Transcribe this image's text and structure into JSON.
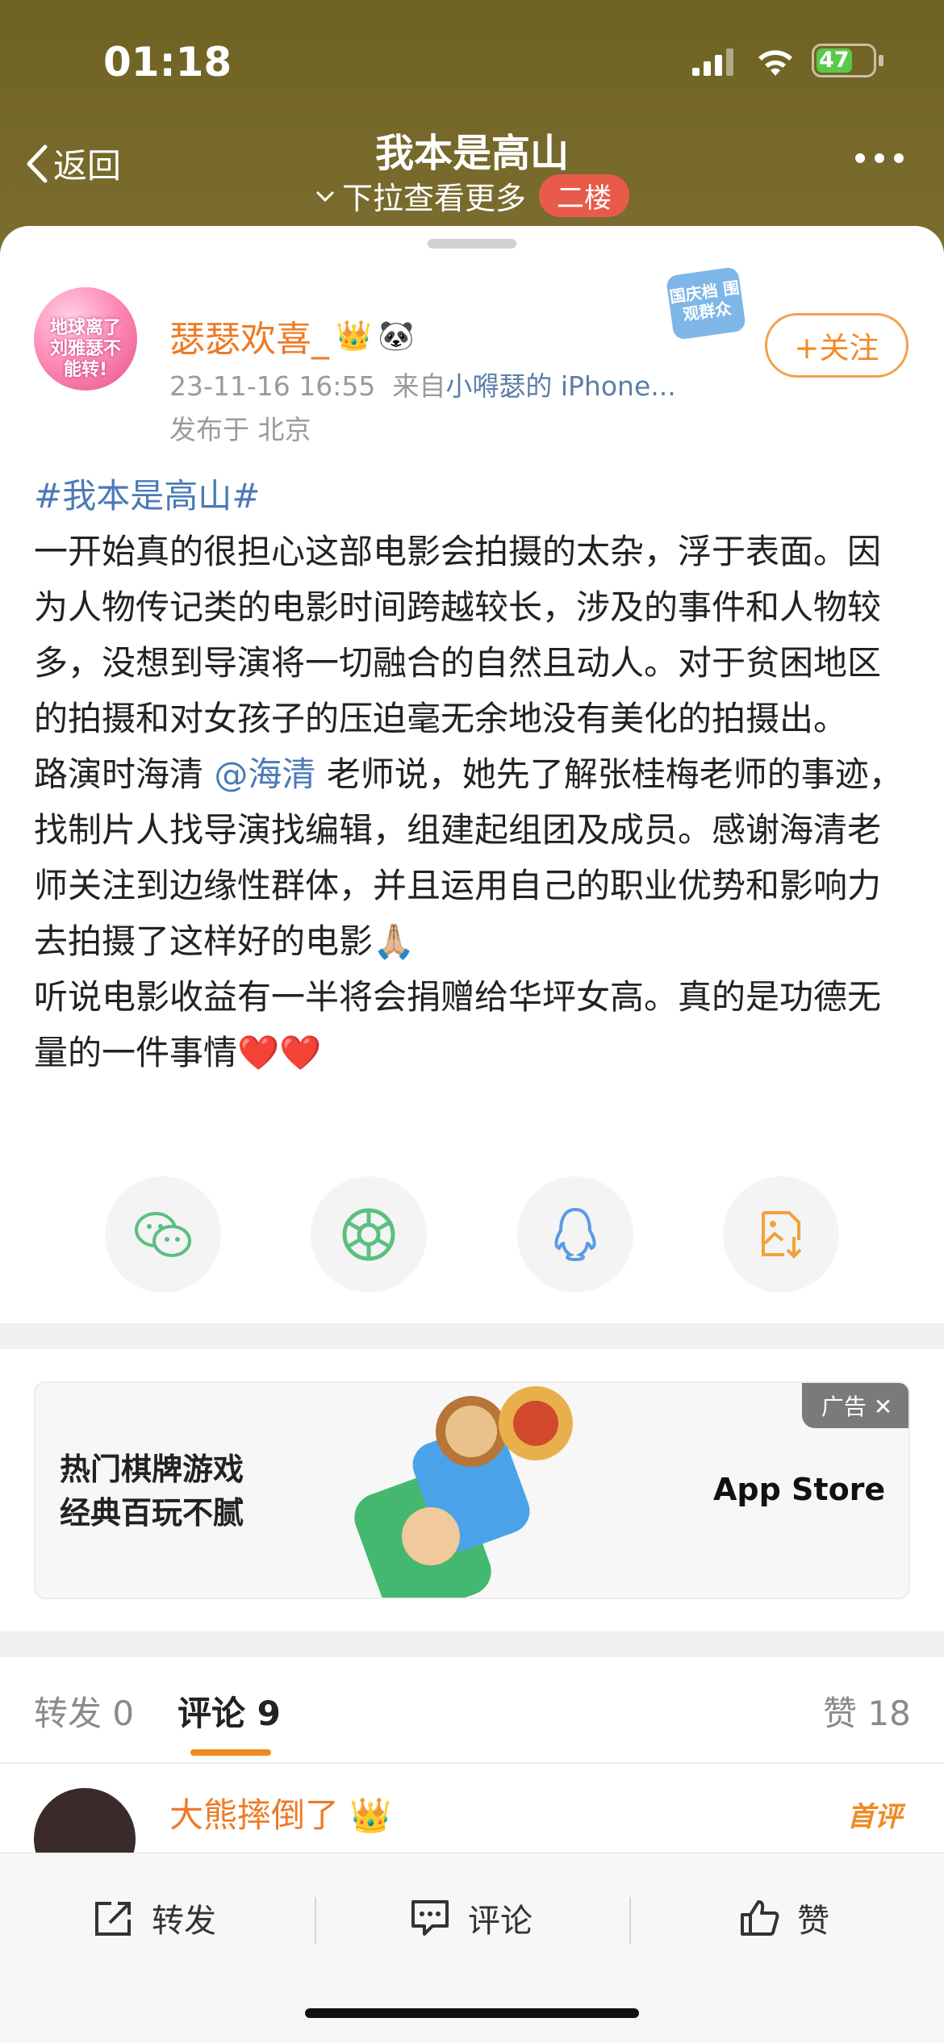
{
  "status": {
    "time": "01:18",
    "battery": "47"
  },
  "nav": {
    "back_label": "返回",
    "title": "我本是高山",
    "pull_hint": "下拉查看更多",
    "floor": "二楼"
  },
  "post": {
    "author": "瑟瑟欢喜_",
    "avatar_text": "地球离了刘雅瑟不能转!",
    "time": "23-11-16 16:55",
    "source_prefix": "来自",
    "source": "小嘚瑟的 iPhone...",
    "location": "发布于 北京",
    "event_badge": "国庆档 围观群众",
    "follow_label": "+关注",
    "hashtag": "#我本是高山#",
    "body1": "一开始真的很担心这部电影会拍摄的太杂，浮于表面。因为人物传记类的电影时间跨越较长，涉及的事件和人物较多，没想到导演将一切融合的自然且动人。对于贫困地区的拍摄和对女孩子的压迫毫无余地没有美化的拍摄出。",
    "body2_pre": "路演时海清 ",
    "mention": "@海清",
    "body2_post": " 老师说，她先了解张桂梅老师的事迹，找制片人找导演找编辑，组建起组团及成员。感谢海清老师关注到边缘性群体，并且运用自己的职业优势和影响力去拍摄了这样好的电影🙏🏼",
    "body3": "听说电影收益有一半将会捐赠给华坪女高。真的是功德无量的一件事情❤️❤️"
  },
  "share_icons": [
    "wechat-icon",
    "moments-icon",
    "qq-icon",
    "save-image-icon"
  ],
  "ad": {
    "line1": "热门棋牌游戏",
    "line2": "经典百玩不腻",
    "store": "App Store",
    "label": "广告 ✕"
  },
  "tabs": {
    "repost": "转发 0",
    "comment": "评论 9",
    "like": "赞 18"
  },
  "comment": {
    "author": "大熊摔倒了",
    "tag": "首评"
  },
  "bottom": {
    "repost": "转发",
    "comment": "评论",
    "like": "赞"
  },
  "colors": {
    "header_bg": "#7c6e30",
    "accent": "#f08a24",
    "link": "#4a7ab8",
    "floor_badge": "#e85b4b"
  }
}
